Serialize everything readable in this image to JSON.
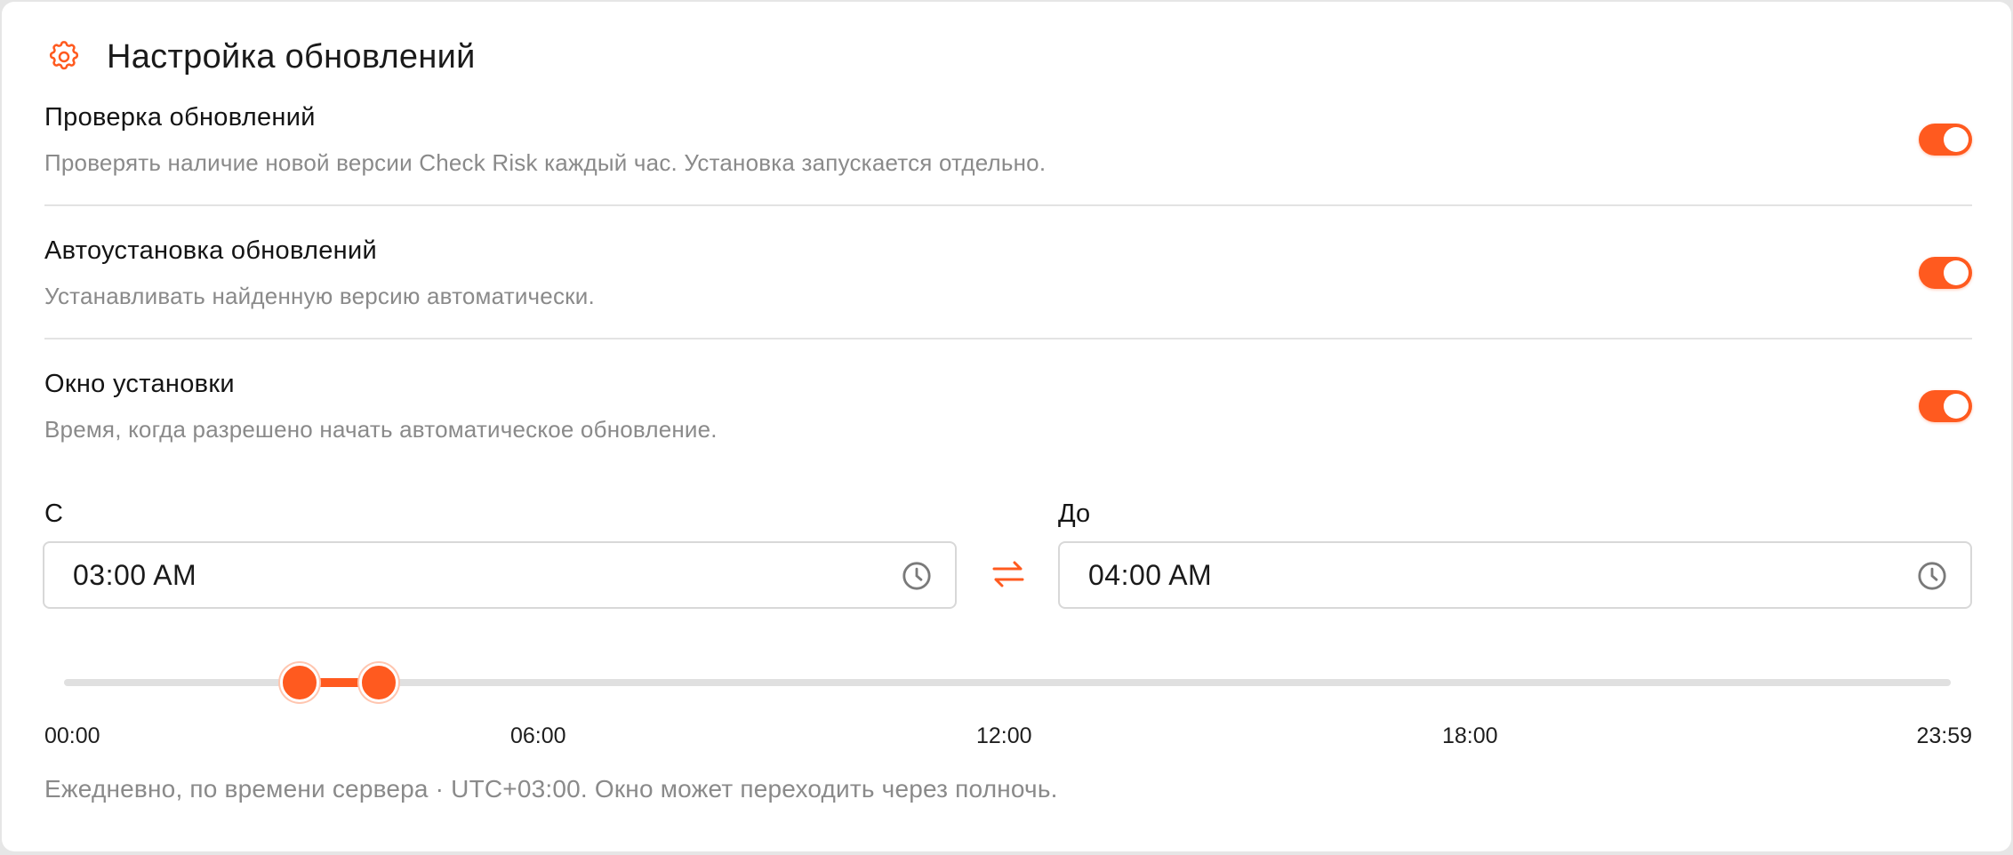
{
  "panel": {
    "title": "Настройка обновлений",
    "icon": "gear-icon",
    "accent_color": "#ff5a1f"
  },
  "settings": [
    {
      "label": "Проверка обновлений",
      "description": "Проверять наличие новой версии Check Risk каждый час. Установка запускается отдельно.",
      "enabled": true
    },
    {
      "label": "Автоустановка обновлений",
      "description": "Устанавливать найденную версию автоматически.",
      "enabled": true
    },
    {
      "label": "Окно установки",
      "description": "Время, когда разрешено начать автоматическое обновление.",
      "enabled": true
    }
  ],
  "window": {
    "from_label": "С",
    "from_value": "03:00 AM",
    "to_label": "До",
    "to_value": "04:00 AM",
    "clock_icon": "clock-icon",
    "swap_icon": "swap-arrows-icon"
  },
  "timeline": {
    "ticks": [
      "00:00",
      "06:00",
      "12:00",
      "18:00",
      "23:59"
    ],
    "range_start_minutes": 180,
    "range_end_minutes": 240,
    "max_minutes": 1439
  },
  "footnote": "Ежедневно, по времени сервера · UTC+03:00. Окно может переходить через полночь."
}
